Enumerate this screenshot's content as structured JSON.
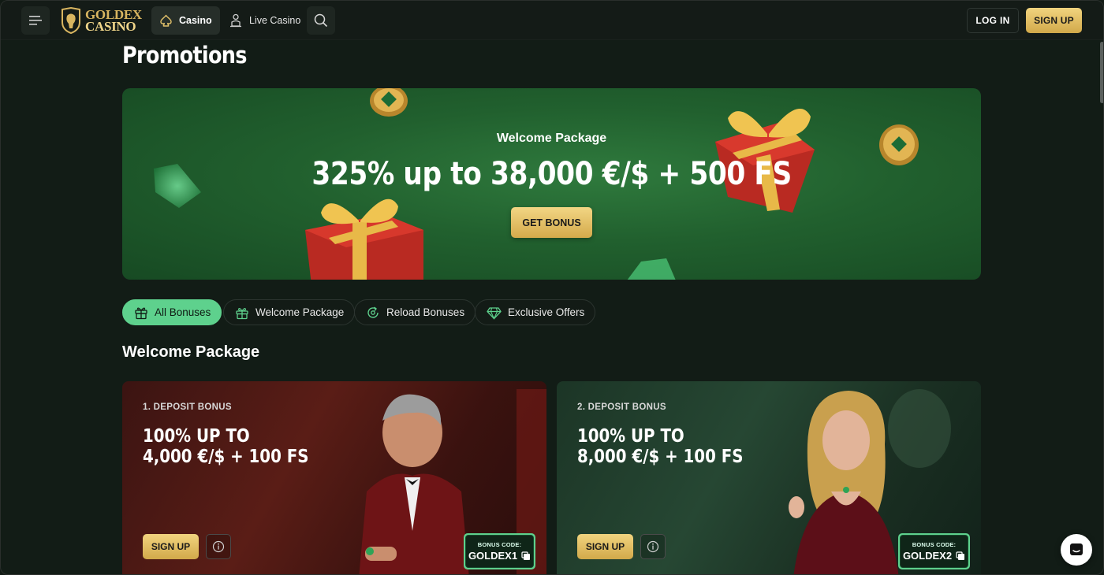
{
  "nav": {
    "logo_line1": "GOLDEX",
    "logo_line2": "CASINO",
    "tabs": [
      {
        "label": "Casino",
        "icon": "spade-icon",
        "active": true
      },
      {
        "label": "Live Casino",
        "icon": "dealer-icon",
        "active": false
      }
    ],
    "login_label": "LOG IN",
    "signup_label": "SIGN UP"
  },
  "page": {
    "title": "Promotions"
  },
  "hero": {
    "subtitle": "Welcome Package",
    "title": "325% up to 38,000 €/$ + 500 FS",
    "button_label": "GET BONUS"
  },
  "filters": [
    {
      "label": "All Bonuses",
      "icon": "gift-icon",
      "active": true
    },
    {
      "label": "Welcome Package",
      "icon": "gift-box-icon",
      "active": false
    },
    {
      "label": "Reload Bonuses",
      "icon": "reload-icon",
      "active": false
    },
    {
      "label": "Exclusive Offers",
      "icon": "diamond-icon",
      "active": false
    }
  ],
  "section": {
    "title": "Welcome Package"
  },
  "cards": [
    {
      "kicker": "1. DEPOSIT BONUS",
      "title_line1": "100% UP TO",
      "title_line2": "4,000 €/$ + 100 FS",
      "button_label": "SIGN UP",
      "code_label": "BONUS CODE:",
      "code": "GOLDEX1"
    },
    {
      "kicker": "2. DEPOSIT BONUS",
      "title_line1": "100% UP TO",
      "title_line2": "8,000 €/$ + 100 FS",
      "button_label": "SIGN UP",
      "code_label": "BONUS CODE:",
      "code": "GOLDEX2"
    }
  ],
  "colors": {
    "accent_green": "#5ed18d",
    "gold": "#d8b560",
    "background": "#121c16"
  }
}
